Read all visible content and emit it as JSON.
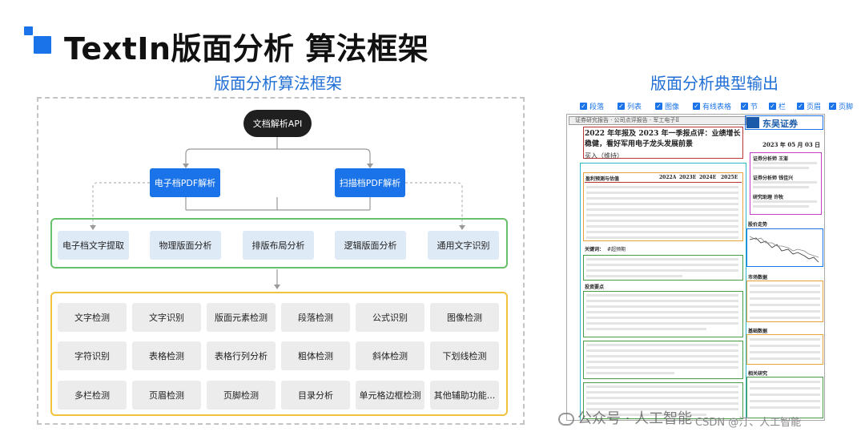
{
  "header": {
    "title": "TextIn版面分析 算法框架",
    "left_subtitle": "版面分析算法框架",
    "right_subtitle": "版面分析典型输出",
    "logo_colors": [
      "#1a73e8",
      "#1a73e8",
      "#1a73e8"
    ]
  },
  "diagram": {
    "root": "文档解析API",
    "parsers": [
      "电子档PDF解析",
      "扫描档PDF解析"
    ],
    "modules": [
      "电子档文字提取",
      "物理版面分析",
      "排版布局分析",
      "逻辑版面分析",
      "通用文字识别"
    ],
    "features": [
      [
        "文字检测",
        "文字识别",
        "版面元素检测",
        "段落检测",
        "公式识别",
        "图像检测"
      ],
      [
        "字符识别",
        "表格检测",
        "表格行列分析",
        "粗体检测",
        "斜体检测",
        "下划线检测"
      ],
      [
        "多栏检测",
        "页眉检测",
        "页脚检测",
        "目录分析",
        "单元格边框检测",
        "其他辅助功能..."
      ]
    ],
    "colors": {
      "root": "#1f1f1f",
      "parser": "#1a73e8",
      "module_border": "#67c06a",
      "feature_border": "#f2c23c"
    }
  },
  "output_legend": [
    {
      "label": "段落",
      "checked": true
    },
    {
      "label": "列表",
      "checked": true
    },
    {
      "label": "图像",
      "checked": true
    },
    {
      "label": "有线表格",
      "checked": true
    },
    {
      "label": "节",
      "checked": true
    },
    {
      "label": "栏",
      "checked": true
    },
    {
      "label": "页眉",
      "checked": true
    },
    {
      "label": "页脚",
      "checked": true
    }
  ],
  "document": {
    "header_line": "证券研究报告 · 公司点评报告 · 军工电子Ⅱ",
    "report_title": "2022 年年报及 2023 年一季报点评：业绩增长稳健，看好军用电子龙头发展前景",
    "rating": "买入（维持）",
    "broker": "东吴证券",
    "date": "2023 年 05 月 03 日",
    "table_title": "盈利预测与估值",
    "table_headers": [
      "2022A",
      "2023E",
      "2024E",
      "2025E"
    ],
    "key_words_label": "关键词：",
    "key_words": "#超预期",
    "invest_label": "投资要点",
    "stock_chart_label": "股价走势",
    "market_label": "市场数据",
    "base_label": "基础数据",
    "related_label": "相关研究",
    "analysts": [
      "证券分析师 王澎",
      "证券分析师 钱佳兴",
      "研究助理 许牧"
    ]
  },
  "watermark": {
    "wechat": "公众号 · 人工智能",
    "csdn": "CSDN @汀、人工智能"
  }
}
